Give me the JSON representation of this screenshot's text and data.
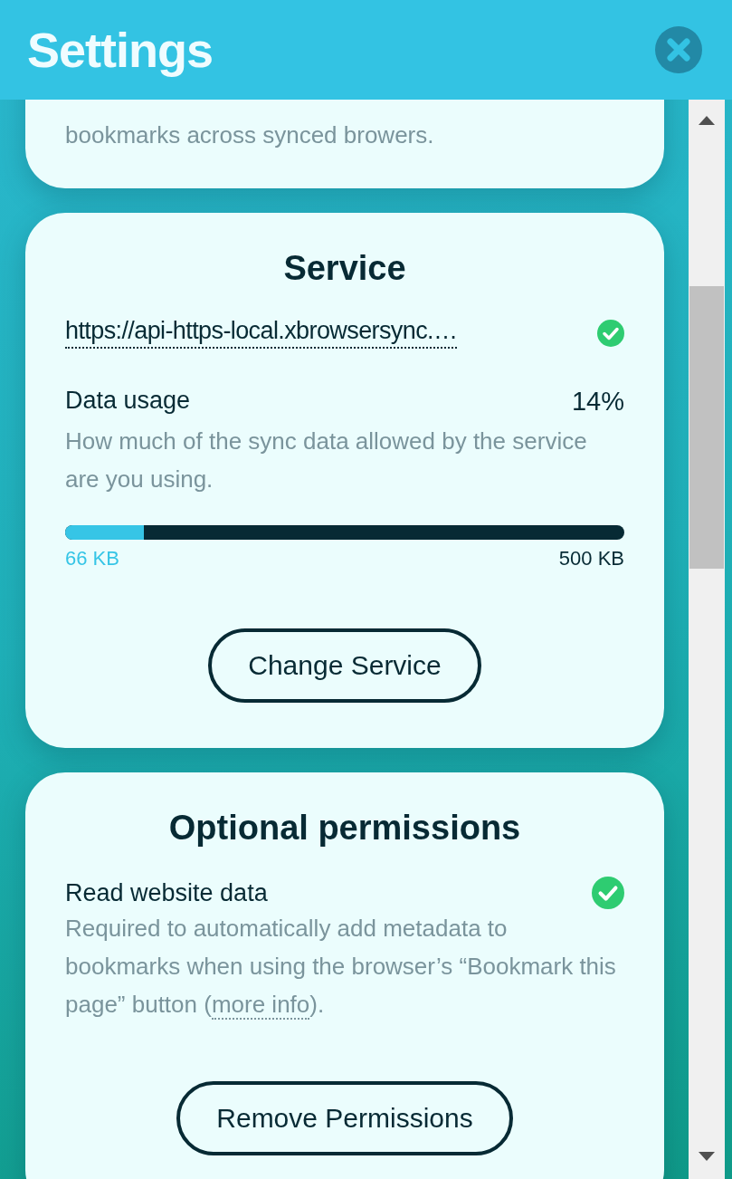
{
  "header": {
    "title": "Settings"
  },
  "sync_card": {
    "description": "bookmarks across synced browers."
  },
  "service": {
    "title": "Service",
    "url": "https://api-https-local.xbrowsersync.…",
    "online": true,
    "usage": {
      "label": "Data usage",
      "percent": "14%",
      "description": "How much of the sync data allowed by the service are you using.",
      "level": 0.14,
      "used": "66 KB",
      "total": "500 KB"
    },
    "button": "Change Service"
  },
  "permissions": {
    "title": "Optional permissions",
    "items": [
      {
        "label": "Read website data",
        "granted": true,
        "description_before": "Required to automatically add metadata to bookmarks when using the browser’s “Bookmark this page” button (",
        "link": "more info",
        "description_after": ")."
      }
    ],
    "button": "Remove Permissions"
  }
}
